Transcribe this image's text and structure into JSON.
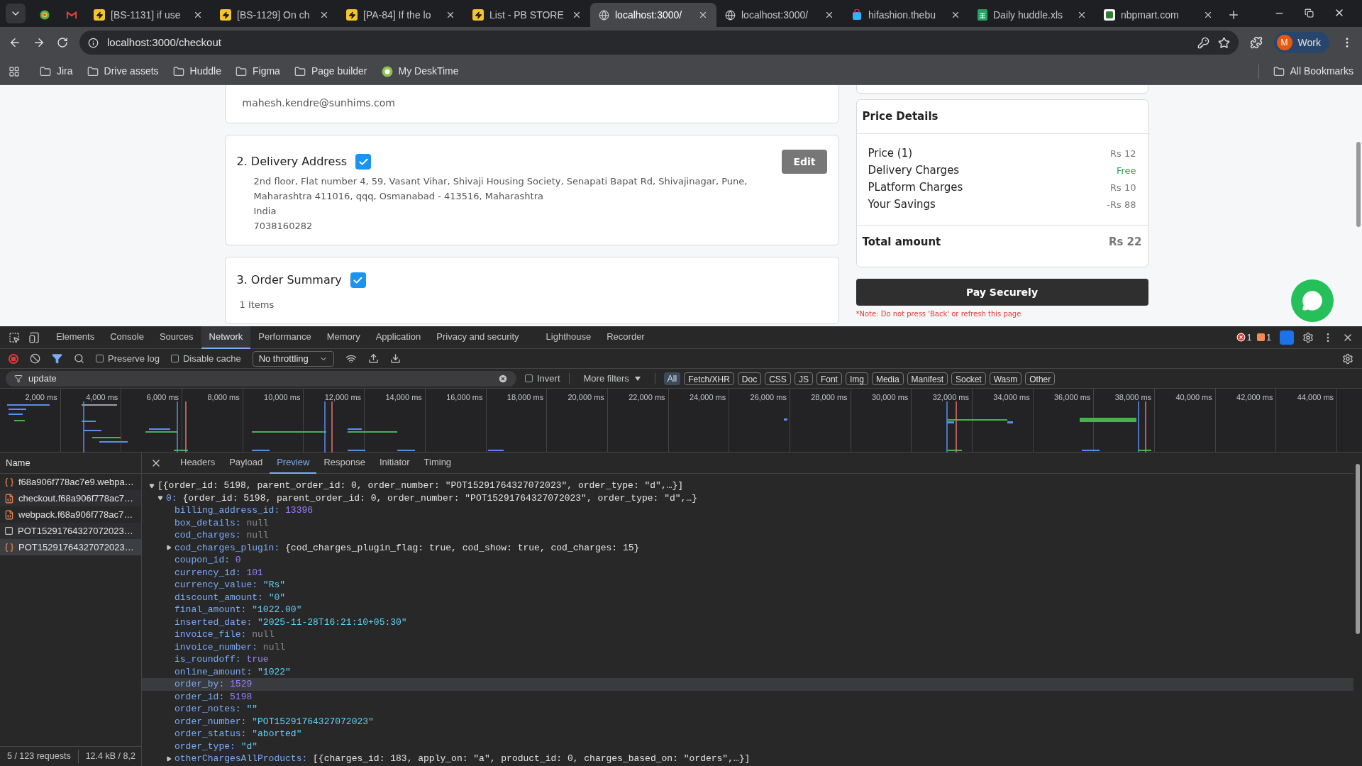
{
  "browser": {
    "tabs": [
      {
        "selected": false
      },
      {
        "selected": false
      },
      {
        "title": "[BS-1131] if use",
        "selected": false
      },
      {
        "title": "[BS-1129] On ch",
        "selected": false
      },
      {
        "title": "[PA-84] If the lo",
        "selected": false
      },
      {
        "title": "List - PB STORE",
        "selected": false
      },
      {
        "title": "localhost:3000/",
        "selected": true
      },
      {
        "title": "localhost:3000/",
        "selected": false
      },
      {
        "title": "hifashion.thebu",
        "selected": false
      },
      {
        "title": "Daily huddle.xls",
        "selected": false
      },
      {
        "title": "nbpmart.com",
        "selected": false
      }
    ],
    "address": "localhost:3000/checkout",
    "profile": {
      "initial": "M",
      "label": "Work"
    },
    "bookmarks": [
      {
        "label": "Jira"
      },
      {
        "label": "Drive assets"
      },
      {
        "label": "Huddle"
      },
      {
        "label": "Figma"
      },
      {
        "label": "Page builder"
      },
      {
        "label": "My DeskTime"
      }
    ],
    "all_bookmarks": "All Bookmarks"
  },
  "checkout": {
    "email": "mahesh.kendre@sunhims.com",
    "sections": [
      {
        "title": "2. Delivery Address",
        "checked": true,
        "button": "Edit",
        "lines": [
          "2nd floor, Flat number 4, 59, Vasant Vihar, Shivaji Housing Society, Senapati Bapat Rd, Shivajinagar, Pune,",
          "Maharashtra 411016, qqq, Osmanabad - 413516, Maharashtra",
          "India",
          "7038160282"
        ]
      },
      {
        "title": "3. Order Summary",
        "checked": true,
        "lines": [
          "1 Items"
        ]
      }
    ],
    "price_details": {
      "title": "Price Details",
      "rows": [
        {
          "label": "Price (1)",
          "value": "Rs 12",
          "kind": "muted"
        },
        {
          "label": "Delivery Charges",
          "value": "Free",
          "kind": "positive"
        },
        {
          "label": "PLatform Charges",
          "value": "Rs 10",
          "kind": "muted"
        },
        {
          "label": "Your Savings",
          "value": "-Rs 88",
          "kind": "muted"
        }
      ],
      "total_label": "Total amount",
      "total_value": "Rs 22"
    },
    "pay_button": "Pay Securely",
    "note": "*Note: Do not press 'Back' or refresh this page"
  },
  "devtools": {
    "tabs": [
      {
        "label": "Elements",
        "selected": false
      },
      {
        "label": "Console",
        "selected": false
      },
      {
        "label": "Sources",
        "selected": false
      },
      {
        "label": "Network",
        "selected": true
      },
      {
        "label": "Performance",
        "selected": false
      },
      {
        "label": "Memory",
        "selected": false
      },
      {
        "label": "Application",
        "selected": false
      },
      {
        "label": "Privacy and security",
        "selected": false
      },
      {
        "label": "Lighthouse",
        "selected": false
      },
      {
        "label": "Recorder",
        "selected": false
      }
    ],
    "errors": "1",
    "warnings": "1",
    "preserve_log": {
      "label": "Preserve log",
      "checked": false
    },
    "disable_cache": {
      "label": "Disable cache",
      "checked": false
    },
    "throttling": "No throttling",
    "filter": "update",
    "invert": {
      "label": "Invert",
      "checked": false
    },
    "more_filters": "More filters",
    "types": [
      {
        "label": "All",
        "selected": true
      },
      {
        "label": "Fetch/XHR",
        "selected": false
      },
      {
        "label": "Doc",
        "selected": false
      },
      {
        "label": "CSS",
        "selected": false
      },
      {
        "label": "JS",
        "selected": false
      },
      {
        "label": "Font",
        "selected": false
      },
      {
        "label": "Img",
        "selected": false
      },
      {
        "label": "Media",
        "selected": false
      },
      {
        "label": "Manifest",
        "selected": false
      },
      {
        "label": "Socket",
        "selected": false
      },
      {
        "label": "Wasm",
        "selected": false
      },
      {
        "label": "Other",
        "selected": false
      }
    ],
    "timeline_ticks": [
      "2,000 ms",
      "4,000 ms",
      "6,000 ms",
      "8,000 ms",
      "10,000 ms",
      "12,000 ms",
      "14,000 ms",
      "16,000 ms",
      "18,000 ms",
      "20,000 ms",
      "22,000 ms",
      "24,000 ms",
      "26,000 ms",
      "28,000 ms",
      "30,000 ms",
      "32,000 ms",
      "34,000 ms",
      "36,000 ms",
      "38,000 ms",
      "40,000 ms",
      "42,000 ms",
      "44,000 ms"
    ],
    "name_header": "Name",
    "requests": [
      {
        "name": "f68a906f778ac7e9.webpa…",
        "kind": "fetch",
        "selected": false
      },
      {
        "name": "checkout.f68a906f778ac7…",
        "kind": "script",
        "selected": false
      },
      {
        "name": "webpack.f68a906f778ac7…",
        "kind": "script",
        "selected": false
      },
      {
        "name": "POT15291764327072023…",
        "kind": "doc",
        "selected": false
      },
      {
        "name": "POT15291764327072023…",
        "kind": "fetch",
        "selected": true
      }
    ],
    "status": [
      "5 / 123 requests",
      "12.4 kB / 8,2"
    ],
    "detail_tabs": [
      {
        "label": "Headers",
        "selected": false
      },
      {
        "label": "Payload",
        "selected": false
      },
      {
        "label": "Preview",
        "selected": true
      },
      {
        "label": "Response",
        "selected": false
      },
      {
        "label": "Initiator",
        "selected": false
      },
      {
        "label": "Timing",
        "selected": false
      }
    ],
    "preview": [
      {
        "text": "[{order_id: 5198, parent_order_id: 0, order_number: \"POT15291764327072023\", order_type: \"d\",…}]",
        "expanded": true,
        "children": [
          {
            "key": "0:",
            "text": "{order_id: 5198, parent_order_id: 0, order_number: \"POT15291764327072023\", order_type: \"d\",…}",
            "expanded": true,
            "children": [
              {
                "key": "billing_address_id:",
                "value": "13396",
                "kind": "number",
                "hovered": false
              },
              {
                "key": "box_details:",
                "value": "null",
                "kind": "null",
                "hovered": false
              },
              {
                "key": "cod_charges:",
                "value": "null",
                "kind": "null",
                "hovered": false
              },
              {
                "key": "cod_charges_plugin:",
                "value": "{cod_charges_plugin_flag: true, cod_show: true, cod_charges: 15}",
                "kind": "object",
                "expanded": false,
                "hovered": false
              },
              {
                "key": "coupon_id:",
                "value": "0",
                "kind": "number",
                "hovered": false
              },
              {
                "key": "currency_id:",
                "value": "101",
                "kind": "number",
                "hovered": false
              },
              {
                "key": "currency_value:",
                "value": "\"Rs\"",
                "kind": "string",
                "hovered": false
              },
              {
                "key": "discount_amount:",
                "value": "\"0\"",
                "kind": "string",
                "hovered": false
              },
              {
                "key": "final_amount:",
                "value": "\"1022.00\"",
                "kind": "string",
                "hovered": false
              },
              {
                "key": "inserted_date:",
                "value": "\"2025-11-28T16:21:10+05:30\"",
                "kind": "string",
                "hovered": false
              },
              {
                "key": "invoice_file:",
                "value": "null",
                "kind": "null",
                "hovered": false
              },
              {
                "key": "invoice_number:",
                "value": "null",
                "kind": "null",
                "hovered": false
              },
              {
                "key": "is_roundoff:",
                "value": "true",
                "kind": "boolean",
                "hovered": false
              },
              {
                "key": "online_amount:",
                "value": "\"1022\"",
                "kind": "string",
                "hovered": false
              },
              {
                "key": "order_by:",
                "value": "1529",
                "kind": "number",
                "hovered": true
              },
              {
                "key": "order_id:",
                "value": "5198",
                "kind": "number",
                "hovered": false
              },
              {
                "key": "order_notes:",
                "value": "\"\"",
                "kind": "string",
                "hovered": false
              },
              {
                "key": "order_number:",
                "value": "\"POT15291764327072023\"",
                "kind": "string",
                "hovered": false
              },
              {
                "key": "order_status:",
                "value": "\"aborted\"",
                "kind": "string",
                "hovered": false
              },
              {
                "key": "order_type:",
                "value": "\"d\"",
                "kind": "string",
                "hovered": false
              },
              {
                "key": "otherChargesAllProducts:",
                "value": "[{charges_id: 183, apply_on: \"a\", product_id: 0, charges_based_on: \"orders\",…}]",
                "kind": "object",
                "expanded": false,
                "hovered": false
              }
            ]
          }
        ]
      }
    ]
  }
}
